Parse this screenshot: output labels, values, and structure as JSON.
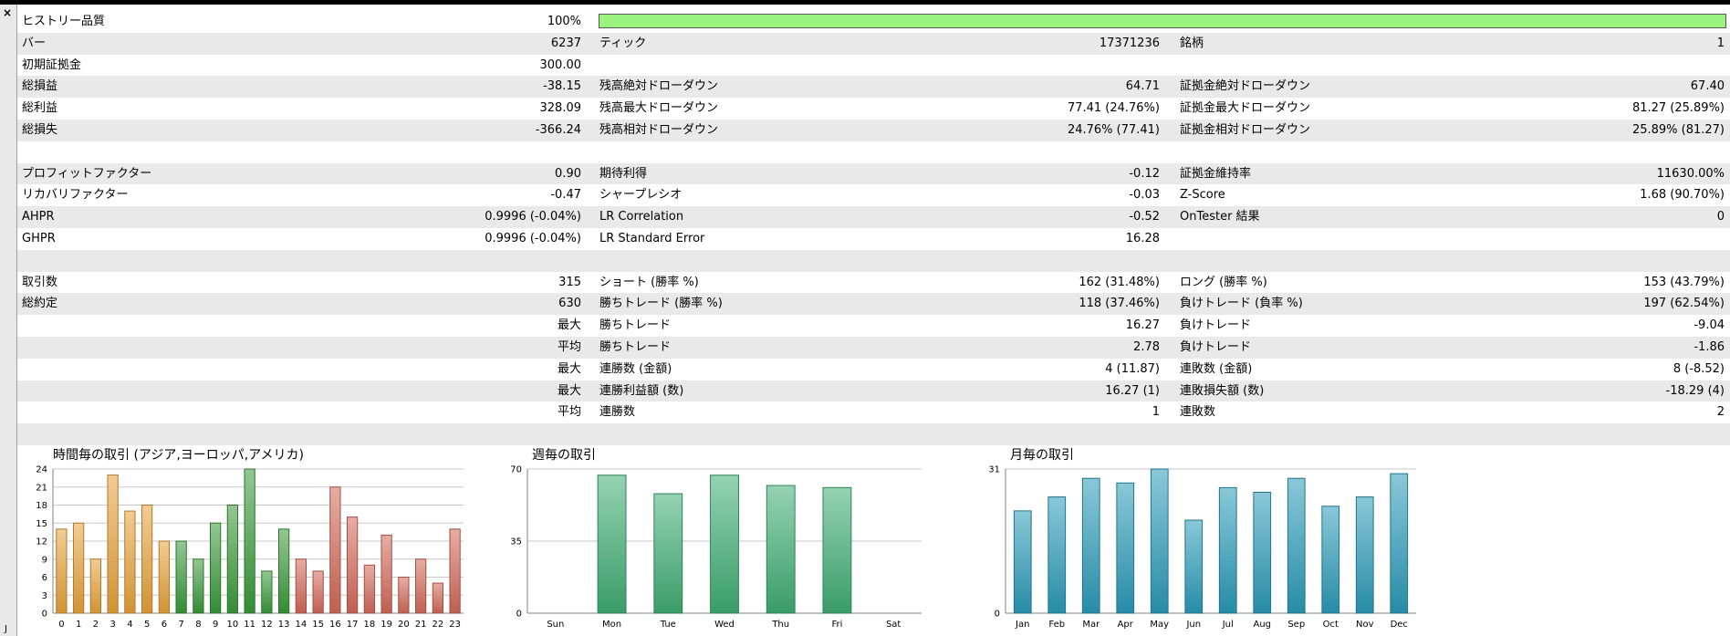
{
  "window": {
    "close_glyph": "×",
    "side_tab": "J"
  },
  "quality": {
    "label": "ヒストリー品質",
    "value": "100%",
    "bar_fraction": 1.0,
    "bar_color": "#99f37d"
  },
  "rows": [
    {
      "cells": [
        [
          "バー",
          "6237"
        ],
        [
          "ティック",
          "17371236"
        ],
        [
          "銘柄",
          "1"
        ]
      ]
    },
    {
      "cells": [
        [
          "初期証拠金",
          "300.00"
        ],
        [
          "",
          ""
        ],
        [
          "",
          ""
        ]
      ]
    },
    {
      "cells": [
        [
          "総損益",
          "-38.15"
        ],
        [
          "残高絶対ドローダウン",
          "64.71"
        ],
        [
          "証拠金絶対ドローダウン",
          "67.40"
        ]
      ]
    },
    {
      "cells": [
        [
          "総利益",
          "328.09"
        ],
        [
          "残高最大ドローダウン",
          "77.41 (24.76%)"
        ],
        [
          "証拠金最大ドローダウン",
          "81.27 (25.89%)"
        ]
      ]
    },
    {
      "cells": [
        [
          "総損失",
          "-366.24"
        ],
        [
          "残高相対ドローダウン",
          "24.76% (77.41)"
        ],
        [
          "証拠金相対ドローダウン",
          "25.89% (81.27)"
        ]
      ]
    },
    {
      "cells": [
        [
          "",
          ""
        ],
        [
          "",
          ""
        ],
        [
          "",
          ""
        ]
      ]
    },
    {
      "cells": [
        [
          "プロフィットファクター",
          "0.90"
        ],
        [
          "期待利得",
          "-0.12"
        ],
        [
          "証拠金維持率",
          "11630.00%"
        ]
      ]
    },
    {
      "cells": [
        [
          "リカバリファクター",
          "-0.47"
        ],
        [
          "シャープレシオ",
          "-0.03"
        ],
        [
          "Z-Score",
          "1.68 (90.70%)"
        ]
      ]
    },
    {
      "cells": [
        [
          "AHPR",
          "0.9996 (-0.04%)"
        ],
        [
          "LR Correlation",
          "-0.52"
        ],
        [
          "OnTester 結果",
          "0"
        ]
      ]
    },
    {
      "cells": [
        [
          "GHPR",
          "0.9996 (-0.04%)"
        ],
        [
          "LR Standard Error",
          "16.28"
        ],
        [
          "",
          ""
        ]
      ]
    },
    {
      "cells": [
        [
          "",
          ""
        ],
        [
          "",
          ""
        ],
        [
          "",
          ""
        ]
      ]
    },
    {
      "cells": [
        [
          "取引数",
          "315"
        ],
        [
          "ショート (勝率 %)",
          "162 (31.48%)"
        ],
        [
          "ロング (勝率 %)",
          "153 (43.79%)"
        ]
      ]
    },
    {
      "cells": [
        [
          "総約定",
          "630"
        ],
        [
          "勝ちトレード (勝率 %)",
          "118 (37.46%)"
        ],
        [
          "負けトレード (負率 %)",
          "197 (62.54%)"
        ]
      ]
    },
    {
      "cells": [
        [
          "",
          "最大"
        ],
        [
          "勝ちトレード",
          "16.27"
        ],
        [
          "負けトレード",
          "-9.04"
        ]
      ]
    },
    {
      "cells": [
        [
          "",
          "平均"
        ],
        [
          "勝ちトレード",
          "2.78"
        ],
        [
          "負けトレード",
          "-1.86"
        ]
      ]
    },
    {
      "cells": [
        [
          "",
          "最大"
        ],
        [
          "連勝数 (金額)",
          "4 (11.87)"
        ],
        [
          "連敗数 (金額)",
          "8 (-8.52)"
        ]
      ]
    },
    {
      "cells": [
        [
          "",
          "最大"
        ],
        [
          "連勝利益額 (数)",
          "16.27 (1)"
        ],
        [
          "連敗損失額 (数)",
          "-18.29 (4)"
        ]
      ]
    },
    {
      "cells": [
        [
          "",
          "平均"
        ],
        [
          "連勝数",
          "1"
        ],
        [
          "連敗数",
          "2"
        ]
      ]
    },
    {
      "cells": [
        [
          "",
          ""
        ],
        [
          "",
          ""
        ],
        [
          "",
          ""
        ]
      ]
    }
  ],
  "chart_data": [
    {
      "type": "bar",
      "title": "時間毎の取引 (アジア,ヨーロッパ,アメリカ)",
      "categories": [
        "0",
        "1",
        "2",
        "3",
        "4",
        "5",
        "6",
        "7",
        "8",
        "9",
        "10",
        "11",
        "12",
        "13",
        "14",
        "15",
        "16",
        "17",
        "18",
        "19",
        "20",
        "21",
        "22",
        "23"
      ],
      "values": [
        14,
        15,
        9,
        23,
        17,
        18,
        12,
        12,
        9,
        15,
        18,
        24,
        7,
        14,
        9,
        7,
        21,
        16,
        8,
        13,
        6,
        9,
        5,
        14
      ],
      "ylim": [
        0,
        24
      ],
      "yticks": [
        "0",
        "3",
        "6",
        "9",
        "12",
        "15",
        "18",
        "21",
        "24"
      ],
      "grid": true,
      "colors": {
        "asia": "#e8a33a",
        "europe": "#3a9a3a",
        "america": "#d46a5a"
      }
    },
    {
      "type": "bar",
      "title": "週毎の取引",
      "categories": [
        "Sun",
        "Mon",
        "Tue",
        "Wed",
        "Thu",
        "Fri",
        "Sat"
      ],
      "values": [
        0,
        67,
        58,
        67,
        62,
        61,
        0
      ],
      "ylim": [
        0,
        70
      ],
      "yticks": [
        "0",
        "35",
        "70"
      ],
      "grid": true,
      "colors": {
        "bar": "#3fae74"
      }
    },
    {
      "type": "bar",
      "title": "月毎の取引",
      "categories": [
        "Jan",
        "Feb",
        "Mar",
        "Apr",
        "May",
        "Jun",
        "Jul",
        "Aug",
        "Sep",
        "Oct",
        "Nov",
        "Dec"
      ],
      "values": [
        22,
        25,
        29,
        28,
        31,
        20,
        27,
        26,
        29,
        23,
        25,
        30
      ],
      "ylim": [
        0,
        31
      ],
      "yticks": [
        "0",
        "31"
      ],
      "grid": true,
      "colors": {
        "bar": "#2a9bb8"
      }
    }
  ]
}
